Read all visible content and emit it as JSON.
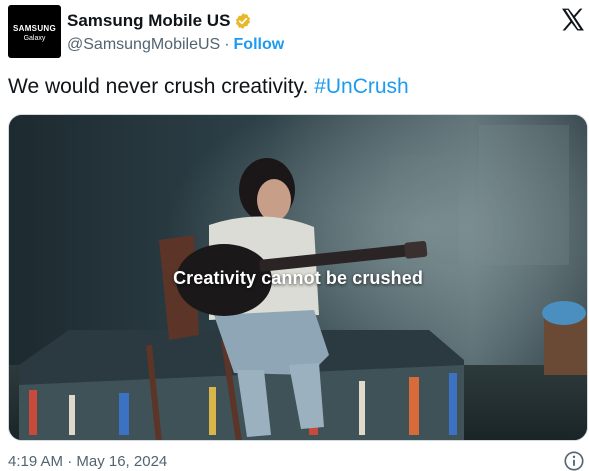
{
  "author": {
    "display_name": "Samsung Mobile US",
    "handle": "@SamsungMobileUS",
    "separator": "·",
    "follow_label": "Follow",
    "avatar_brand": "SAMSUNG",
    "avatar_sub": "Galaxy",
    "verified_color": "#e8b829"
  },
  "tweet": {
    "text": "We would never crush creativity.",
    "hashtag": "#UnCrush",
    "timestamp": "4:19 AM · May 16, 2024"
  },
  "media": {
    "caption": "Creativity cannot be crushed"
  },
  "icons": {
    "platform_logo": "x-logo-icon",
    "info": "info-icon",
    "verified": "verified-badge-icon"
  },
  "colors": {
    "link": "#1d9bf0",
    "text": "#0f1419",
    "secondary": "#536471"
  }
}
